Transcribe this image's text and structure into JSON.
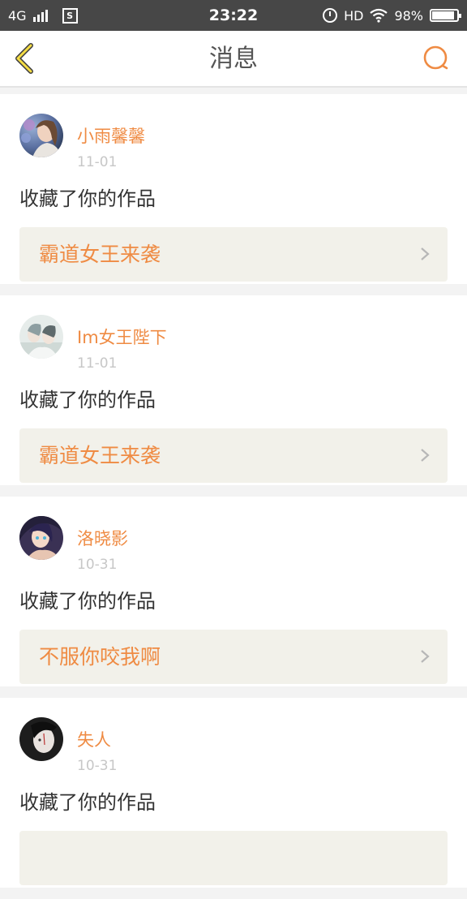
{
  "status_bar": {
    "network": "4G",
    "s_badge": "S",
    "time": "23:22",
    "hd": "HD",
    "battery": "98%",
    "battery_level": 0.98,
    "icons": [
      "signal-icon",
      "s-app-icon",
      "alarm-icon",
      "wifi-icon",
      "battery-icon"
    ]
  },
  "header": {
    "title": "消息",
    "back_icon": "chevron-left-icon",
    "search_icon": "search-icon",
    "accent_color": "#ef8b43"
  },
  "messages": [
    {
      "user": "小雨馨馨",
      "date": "11-01",
      "action": "收藏了你的作品",
      "work": "霸道女王来袭"
    },
    {
      "user": "Im女王陛下",
      "date": "11-01",
      "action": "收藏了你的作品",
      "work": "霸道女王来袭"
    },
    {
      "user": "洛晓影",
      "date": "10-31",
      "action": "收藏了你的作品",
      "work": "不服你咬我啊"
    },
    {
      "user": "失人",
      "date": "10-31",
      "action": "收藏了你的作品",
      "work": ""
    }
  ]
}
